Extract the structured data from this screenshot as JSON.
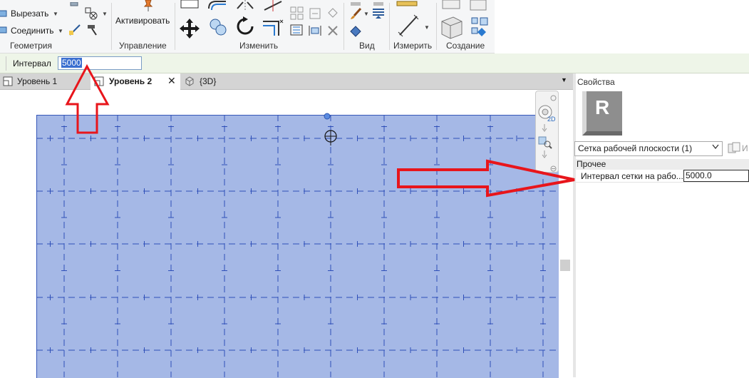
{
  "ribbon": {
    "cut_label": "Вырезать",
    "join_label": "Соединить",
    "activate_label": "Активировать",
    "panels": {
      "geometry": "Геометрия",
      "manage": "Управление",
      "modify": "Изменить",
      "view": "Вид",
      "measure": "Измерить",
      "create": "Создание"
    }
  },
  "options_bar": {
    "interval_label": "Интервал",
    "interval_value": "5000"
  },
  "tabs": [
    {
      "label": "Уровень 1"
    },
    {
      "label": "Уровень 2",
      "active": true
    },
    {
      "label": "{3D}"
    }
  ],
  "canvas": {
    "workplane_color": "#a5b8e6",
    "grid_line_color": "#2f4fb8"
  },
  "properties": {
    "title": "Свойства",
    "type_selector": "Сетка рабочей плоскости (1)",
    "edit_type_label": "И",
    "category": "Прочее",
    "rows": [
      {
        "name": "Интервал сетки на рабо...",
        "value": "5000.0"
      }
    ]
  },
  "annotations": {
    "arrow_color": "#e8151b"
  }
}
